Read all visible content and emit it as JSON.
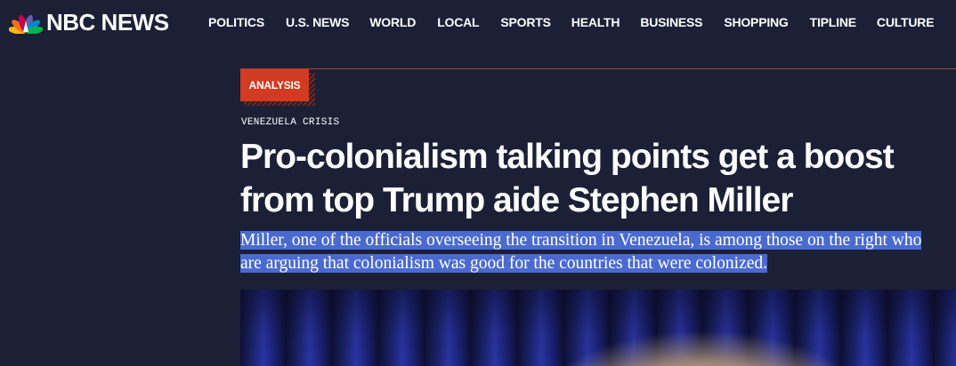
{
  "brand": {
    "name": "NBC NEWS",
    "peacock_colors": [
      "#fcb711",
      "#f37021",
      "#cc004c",
      "#6460aa",
      "#0089d0",
      "#0db14b"
    ]
  },
  "nav": {
    "items": [
      "POLITICS",
      "U.S. NEWS",
      "WORLD",
      "LOCAL",
      "SPORTS",
      "HEALTH",
      "BUSINESS",
      "SHOPPING",
      "TIPLINE",
      "CULTURE"
    ]
  },
  "article": {
    "label": "ANALYSIS",
    "eyebrow": "VENEZUELA CRISIS",
    "headline": "Pro-colonialism talking points get a boost from top Trump aide Stephen Miller",
    "dek": "Miller, one of the officials overseeing the transition in Venezuela, is among those on the right who are arguing that colonialism was good for the countries that were colonized.",
    "dek_selected": true
  },
  "colors": {
    "background": "#1b2036",
    "accent": "#d03b22",
    "selection": "#4a6ad0"
  }
}
